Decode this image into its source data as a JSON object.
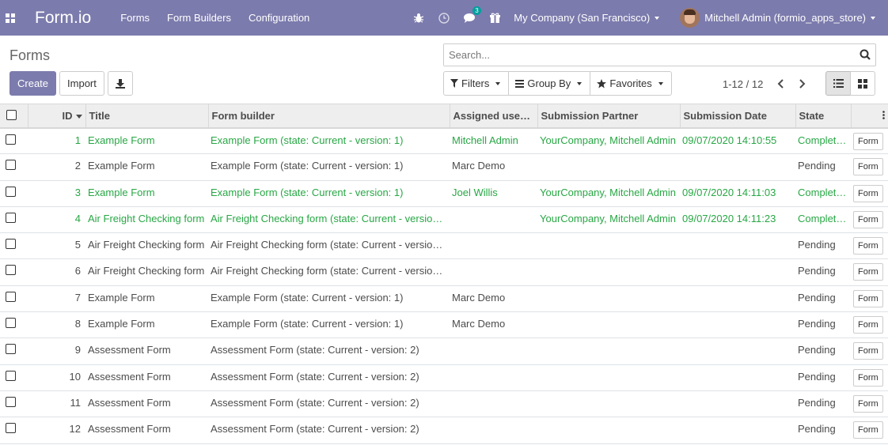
{
  "navbar": {
    "brand": "Form.io",
    "menu": [
      "Forms",
      "Form Builders",
      "Configuration"
    ],
    "message_count": "3",
    "company": "My Company (San Francisco)",
    "user": "Mitchell Admin (formio_apps_store)"
  },
  "control": {
    "title": "Forms",
    "create_label": "Create",
    "import_label": "Import",
    "search_placeholder": "Search...",
    "filters_label": "Filters",
    "groupby_label": "Group By",
    "favorites_label": "Favorites",
    "pager": "1-12 / 12"
  },
  "columns": [
    "ID",
    "Title",
    "Form builder",
    "Assigned user…",
    "Submission Partner",
    "Submission Date",
    "State"
  ],
  "row_button": "Form",
  "rows": [
    {
      "id": "1",
      "title": "Example Form",
      "builder": "Example Form (state: Current - version: 1)",
      "user": "Mitchell Admin",
      "partner": "YourCompany, Mitchell Admin",
      "date": "09/07/2020 14:10:55",
      "state": "Complet…",
      "done": true
    },
    {
      "id": "2",
      "title": "Example Form",
      "builder": "Example Form (state: Current - version: 1)",
      "user": "Marc Demo",
      "partner": "",
      "date": "",
      "state": "Pending",
      "done": false
    },
    {
      "id": "3",
      "title": "Example Form",
      "builder": "Example Form (state: Current - version: 1)",
      "user": "Joel Willis",
      "partner": "YourCompany, Mitchell Admin",
      "date": "09/07/2020 14:11:03",
      "state": "Complet…",
      "done": true
    },
    {
      "id": "4",
      "title": "Air Freight Checking form",
      "builder": "Air Freight Checking form (state: Current - versio…",
      "user": "",
      "partner": "YourCompany, Mitchell Admin",
      "date": "09/07/2020 14:11:23",
      "state": "Complet…",
      "done": true
    },
    {
      "id": "5",
      "title": "Air Freight Checking form",
      "builder": "Air Freight Checking form (state: Current - versio…",
      "user": "",
      "partner": "",
      "date": "",
      "state": "Pending",
      "done": false
    },
    {
      "id": "6",
      "title": "Air Freight Checking form",
      "builder": "Air Freight Checking form (state: Current - versio…",
      "user": "",
      "partner": "",
      "date": "",
      "state": "Pending",
      "done": false
    },
    {
      "id": "7",
      "title": "Example Form",
      "builder": "Example Form (state: Current - version: 1)",
      "user": "Marc Demo",
      "partner": "",
      "date": "",
      "state": "Pending",
      "done": false
    },
    {
      "id": "8",
      "title": "Example Form",
      "builder": "Example Form (state: Current - version: 1)",
      "user": "Marc Demo",
      "partner": "",
      "date": "",
      "state": "Pending",
      "done": false
    },
    {
      "id": "9",
      "title": "Assessment Form",
      "builder": "Assessment Form (state: Current - version: 2)",
      "user": "",
      "partner": "",
      "date": "",
      "state": "Pending",
      "done": false
    },
    {
      "id": "10",
      "title": "Assessment Form",
      "builder": "Assessment Form (state: Current - version: 2)",
      "user": "",
      "partner": "",
      "date": "",
      "state": "Pending",
      "done": false
    },
    {
      "id": "11",
      "title": "Assessment Form",
      "builder": "Assessment Form (state: Current - version: 2)",
      "user": "",
      "partner": "",
      "date": "",
      "state": "Pending",
      "done": false
    },
    {
      "id": "12",
      "title": "Assessment Form",
      "builder": "Assessment Form (state: Current - version: 2)",
      "user": "",
      "partner": "",
      "date": "",
      "state": "Pending",
      "done": false
    }
  ],
  "colors": {
    "navbar": "#7c7bad",
    "done_text": "#28a745"
  }
}
